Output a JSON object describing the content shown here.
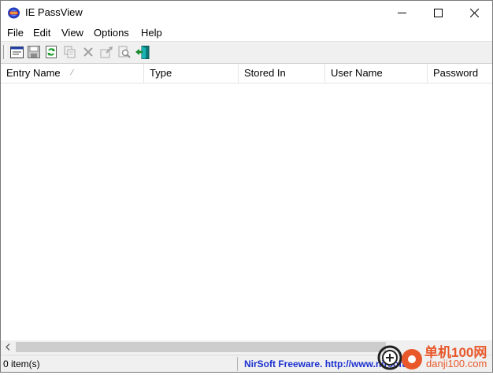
{
  "window": {
    "title": "IE PassView",
    "icons": {
      "app": "ie-passview-app-icon",
      "minimize": "minimize-icon",
      "maximize": "maximize-icon",
      "close": "close-icon"
    }
  },
  "menu": [
    "File",
    "Edit",
    "View",
    "Options",
    "Help"
  ],
  "toolbar": {
    "icons": [
      "properties-icon",
      "save-icon",
      "refresh-icon",
      "copy-icon",
      "delete-icon",
      "export-icon",
      "find-icon",
      "exit-icon"
    ]
  },
  "list": {
    "columns": [
      "Entry Name",
      "Type",
      "Stored In",
      "User Name",
      "Password"
    ],
    "sort_indicator": "⁄",
    "rows": []
  },
  "status": {
    "count": "0 item(s)",
    "link": "NirSoft Freeware.  http://www.nirsoft"
  },
  "watermark": {
    "text_cn": "单机100网",
    "text_url": "danji100.com"
  },
  "colors": {
    "link": "#1a2fd0",
    "toolbar_bg": "#f0f0f0",
    "watermark": "#e8582a"
  }
}
